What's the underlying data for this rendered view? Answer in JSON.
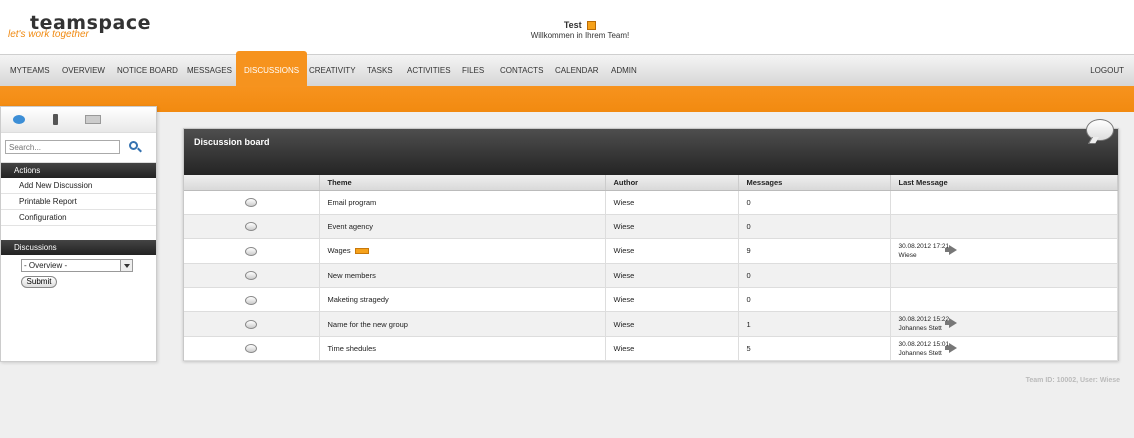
{
  "header": {
    "logo": "teamspace",
    "tagline": "let's work together",
    "welcome_title": "Test",
    "welcome_sub": "Willkommen in Ihrem Team!"
  },
  "nav": {
    "items": [
      {
        "label": "MYTEAMS"
      },
      {
        "label": "OVERVIEW"
      },
      {
        "label": "NOTICE BOARD"
      },
      {
        "label": "MESSAGES"
      },
      {
        "label": "DISCUSSIONS"
      },
      {
        "label": "CREATIVITY"
      },
      {
        "label": "TASKS"
      },
      {
        "label": "ACTIVITIES"
      },
      {
        "label": "FILES"
      },
      {
        "label": "CONTACTS"
      },
      {
        "label": "CALENDAR"
      },
      {
        "label": "ADMIN"
      }
    ],
    "active": "DISCUSSIONS",
    "logout": "LOGOUT"
  },
  "sidebar": {
    "search_placeholder": "Search...",
    "actions_title": "Actions",
    "actions": [
      {
        "label": "Add New Discussion"
      },
      {
        "label": "Printable Report"
      },
      {
        "label": "Configuration"
      }
    ],
    "discussions_title": "Discussions",
    "select_value": "- Overview -",
    "submit_label": "Submit"
  },
  "board": {
    "title": "Discussion board",
    "columns": [
      "",
      "Theme",
      "Author",
      "Messages",
      "Last Message"
    ],
    "rows": [
      {
        "theme": "Email program",
        "author": "Wiese",
        "messages": "0",
        "last_date": "",
        "last_user": ""
      },
      {
        "theme": "Event agency",
        "author": "Wiese",
        "messages": "0",
        "last_date": "",
        "last_user": ""
      },
      {
        "theme": "Wages",
        "author": "Wiese",
        "messages": "9",
        "last_date": "30.08.2012 17:21",
        "last_user": "Wiese",
        "is_new": true
      },
      {
        "theme": "New members",
        "author": "Wiese",
        "messages": "0",
        "last_date": "",
        "last_user": ""
      },
      {
        "theme": "Maketing stragedy",
        "author": "Wiese",
        "messages": "0",
        "last_date": "",
        "last_user": ""
      },
      {
        "theme": "Name for the new group",
        "author": "Wiese",
        "messages": "1",
        "last_date": "30.08.2012 15:22",
        "last_user": "Johannes Stett"
      },
      {
        "theme": "Time shedules",
        "author": "Wiese",
        "messages": "5",
        "last_date": "30.08.2012 15:01",
        "last_user": "Johannes Stett"
      }
    ]
  },
  "footer": {
    "team_info": "Team ID: 10002, User: Wiese"
  },
  "colors": {
    "accent": "#f7931e",
    "header_dark": "#2b2b2b"
  }
}
